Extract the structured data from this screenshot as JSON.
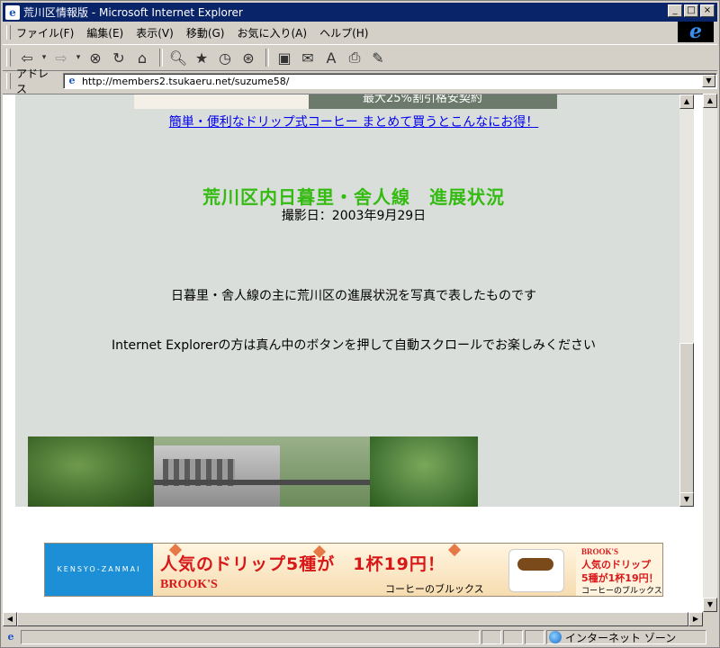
{
  "window": {
    "title": "荒川区情報版 - Microsoft Internet Explorer",
    "controls": {
      "minimize": "_",
      "maximize": "□",
      "close": "×"
    }
  },
  "menu": {
    "items": [
      "ファイル(F)",
      "編集(E)",
      "表示(V)",
      "移動(G)",
      "お気に入り(A)",
      "ヘルプ(H)"
    ]
  },
  "toolbar": {
    "buttons": [
      "back-icon",
      "forward-icon",
      "stop-icon",
      "refresh-icon",
      "home-icon",
      "search-icon",
      "favorites-icon",
      "history-icon",
      "channels-icon",
      "fullscreen-icon",
      "mail-icon",
      "font-icon",
      "print-icon",
      "edit-icon"
    ]
  },
  "address": {
    "label": "アドレス",
    "url": "http://members2.tsukaeru.net/suzume58/"
  },
  "page": {
    "top_banner_text": "最大25%割引格安契約",
    "promo_link": "簡単・便利なドリップ式コーヒー まとめて買うとこんなにお得！",
    "heading": "荒川区内日暮里・舎人線　進展状況",
    "date": "撮影日：2003年9月29日",
    "description": "日暮里・舎人線の主に荒川区の進展状況を写真で表したものです",
    "instruction": "Internet Explorerの方は真ん中のボタンを押して自動スクロールでお楽しみください"
  },
  "ad": {
    "brand": "KENSYO-ZANMAI",
    "headline": "人気のドリップ5種が　1杯19円！",
    "logo": "BROOK'S",
    "sub": "コーヒーのブルックス",
    "side_logo": "BROOK'S",
    "side_line1": "人気のドリップ",
    "side_line2": "5種が1杯19円！",
    "side_line3": "コーヒーのブルックス"
  },
  "status": {
    "zone": "インターネット ゾーン"
  },
  "colors": {
    "titlebar": "#0a246a",
    "page_bg": "#dadeda",
    "heading": "#33bb11",
    "link": "#0000ee",
    "ad_red": "#d81818"
  }
}
